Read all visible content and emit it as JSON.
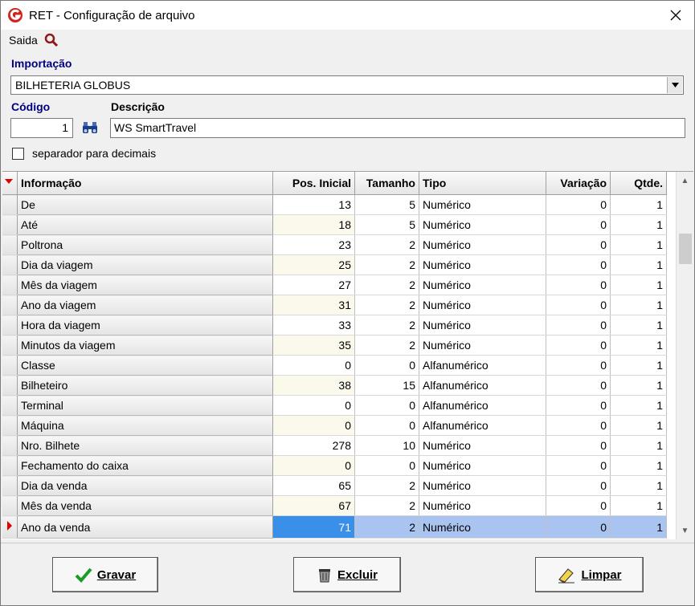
{
  "window": {
    "title": "RET - Configuração de arquivo"
  },
  "menu": {
    "saida_label": "Saida"
  },
  "importacao": {
    "label": "Importação",
    "value": "BILHETERIA GLOBUS"
  },
  "codigo": {
    "label": "Código",
    "value": "1"
  },
  "descricao": {
    "label": "Descrição",
    "value": "WS SmartTravel"
  },
  "decimal_checkbox": {
    "label": "separador para decimais",
    "checked": false
  },
  "grid": {
    "columns": [
      "Informação",
      "Pos. Inicial",
      "Tamanho",
      "Tipo",
      "Variação",
      "Qtde."
    ],
    "selected_row": 16,
    "rows": [
      [
        "De",
        "13",
        "5",
        "Numérico",
        "0",
        "1"
      ],
      [
        "Até",
        "18",
        "5",
        "Numérico",
        "0",
        "1"
      ],
      [
        "Poltrona",
        "23",
        "2",
        "Numérico",
        "0",
        "1"
      ],
      [
        "Dia da viagem",
        "25",
        "2",
        "Numérico",
        "0",
        "1"
      ],
      [
        "Mês da viagem",
        "27",
        "2",
        "Numérico",
        "0",
        "1"
      ],
      [
        "Ano da viagem",
        "31",
        "2",
        "Numérico",
        "0",
        "1"
      ],
      [
        "Hora da viagem",
        "33",
        "2",
        "Numérico",
        "0",
        "1"
      ],
      [
        "Minutos da viagem",
        "35",
        "2",
        "Numérico",
        "0",
        "1"
      ],
      [
        "Classe",
        "0",
        "0",
        "Alfanumérico",
        "0",
        "1"
      ],
      [
        "Bilheteiro",
        "38",
        "15",
        "Alfanumérico",
        "0",
        "1"
      ],
      [
        "Terminal",
        "0",
        "0",
        "Alfanumérico",
        "0",
        "1"
      ],
      [
        "Máquina",
        "0",
        "0",
        "Alfanumérico",
        "0",
        "1"
      ],
      [
        "Nro. Bilhete",
        "278",
        "10",
        "Numérico",
        "0",
        "1"
      ],
      [
        "Fechamento do caixa",
        "0",
        "0",
        "Numérico",
        "0",
        "1"
      ],
      [
        "Dia da venda",
        "65",
        "2",
        "Numérico",
        "0",
        "1"
      ],
      [
        "Mês da venda",
        "67",
        "2",
        "Numérico",
        "0",
        "1"
      ],
      [
        "Ano da venda",
        "71",
        "2",
        "Numérico",
        "0",
        "1"
      ]
    ]
  },
  "buttons": {
    "gravar": "Gravar",
    "excluir": "Excluir",
    "limpar": "Limpar"
  },
  "colors": {
    "selection": "#3a8fe8",
    "selection_row": "#a9c4f0",
    "label_blue": "#000080",
    "indicator_red": "#e00000"
  }
}
